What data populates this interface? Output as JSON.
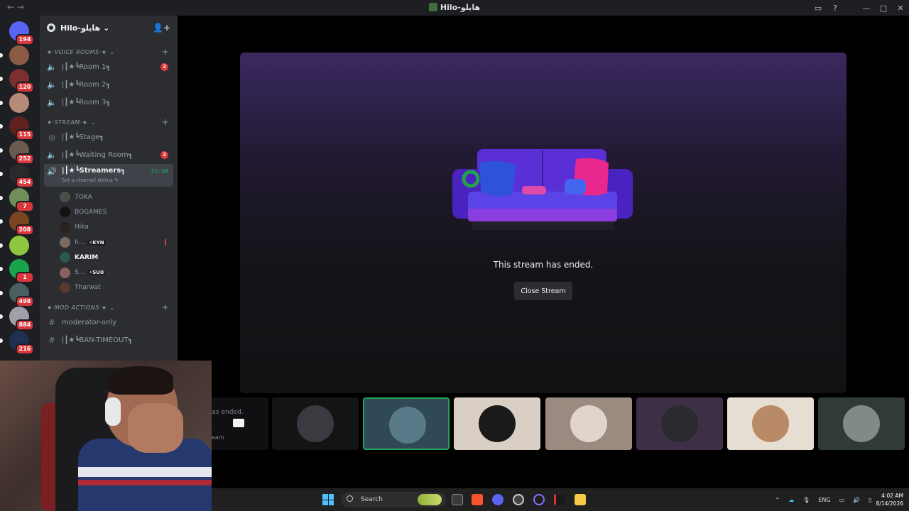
{
  "window": {
    "title": "Hilo-هايلو",
    "icons": [
      "inbox-icon",
      "help-icon",
      "minimize-icon",
      "maximize-icon",
      "close-icon"
    ]
  },
  "guilds": [
    {
      "badge": "194",
      "color": "#5865f2"
    },
    {
      "badge": "",
      "color": "#8a5a44"
    },
    {
      "badge": "120",
      "color": "#7a3030"
    },
    {
      "badge": "",
      "color": "#b78b7a"
    },
    {
      "badge": "115",
      "color": "#602020"
    },
    {
      "badge": "252",
      "color": "#6a5a50"
    },
    {
      "badge": "454",
      "color": "#2a2a2a"
    },
    {
      "badge": "7",
      "color": "#6f8e5a"
    },
    {
      "badge": "208",
      "color": "#7b4520"
    },
    {
      "badge": "",
      "color": "#8dc63f"
    },
    {
      "badge": "1",
      "color": "#1aa34a"
    },
    {
      "badge": "498",
      "color": "#4a6060"
    },
    {
      "badge": "884",
      "color": "#a0a0a8"
    },
    {
      "badge": "216",
      "color": "#203050"
    }
  ],
  "server": {
    "name": "Hilo-هايلو"
  },
  "categories": {
    "voice": "★·VOICE ROOMS·★",
    "stream": "★·STREAM·★",
    "mod": "★·Mod Actions·★"
  },
  "voice_channels": [
    {
      "name": "|┃★┗Room 1┓",
      "count": "2"
    },
    {
      "name": "|┃★┗Room 2┓",
      "count": ""
    },
    {
      "name": "|┃★┗Room 3┓",
      "count": ""
    }
  ],
  "stream_channels": {
    "stage": "|┃★┗Stage┓",
    "waiting": "|┃★┗Waiting Room┓",
    "waiting_count": "2",
    "active": "|┃★┗Streamers┓",
    "active_timer": "55:08",
    "active_status": "Set a channel status"
  },
  "members": [
    {
      "name": "7OKA",
      "tag": "",
      "color": "#4a4f4a"
    },
    {
      "name": "BOGAMES",
      "tag": "",
      "color": "#111111"
    },
    {
      "name": "Hika",
      "tag": "",
      "color": "#2a2020"
    },
    {
      "name": "h...",
      "tag": "⚡KYN",
      "color": "#7a6a60"
    },
    {
      "name": "KARIM",
      "tag": "",
      "color": "#2a5a4a"
    },
    {
      "name": "S...",
      "tag": "⚡SUII",
      "color": "#8a6060"
    },
    {
      "name": "Tharwat",
      "tag": "",
      "color": "#5a3a30"
    }
  ],
  "mod_channels": [
    {
      "name": "moderator-only"
    },
    {
      "name": "|┃★┗BAN-TIMEOUT┓"
    }
  ],
  "stream": {
    "ended_text": "This stream has ended.",
    "close_label": "Close Stream",
    "mini_ended": "eam has ended.",
    "mini_close": "ose Stream"
  },
  "tiles": [
    {
      "bg": "#141414",
      "av": "#3a3a40",
      "selected": false
    },
    {
      "bg": "#2f4a56",
      "av": "#5a7a8a",
      "selected": true
    },
    {
      "bg": "#d9cfc4",
      "av": "#1a1a1a",
      "selected": false
    },
    {
      "bg": "#9a8a80",
      "av": "#e0d5cc",
      "selected": false
    },
    {
      "bg": "#3d2f45",
      "av": "#2a2a30",
      "selected": false
    },
    {
      "bg": "#e6ddd3",
      "av": "#b88a68",
      "selected": false
    },
    {
      "bg": "#303a36",
      "av": "#808a88",
      "selected": false
    }
  ],
  "taskbar": {
    "search_label": "Search",
    "lang": "ENG",
    "time": "4:02 AM",
    "date": "8/14/2026"
  }
}
